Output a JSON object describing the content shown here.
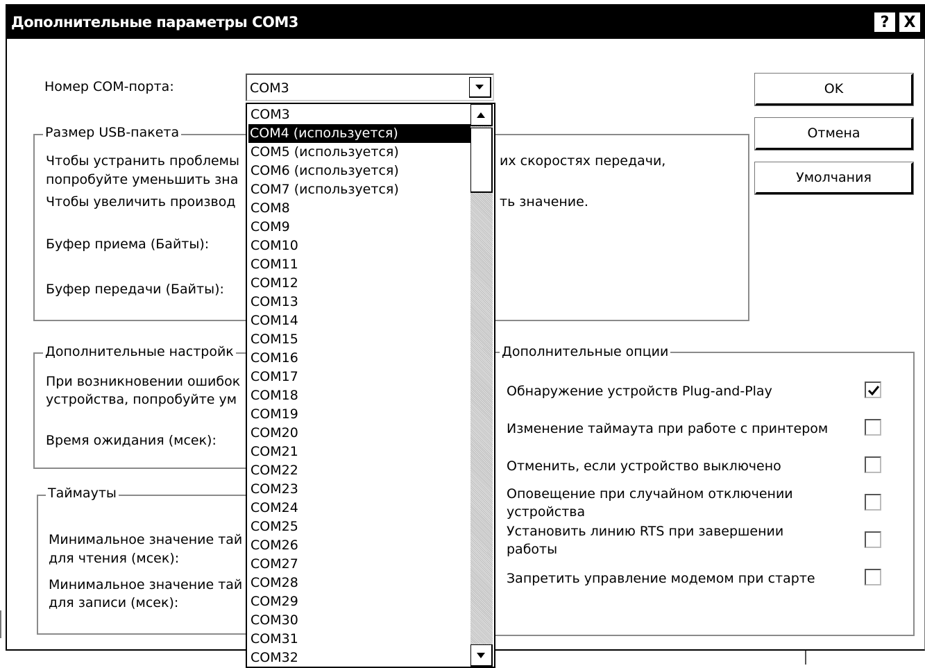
{
  "window": {
    "title": "Дополнительные параметры COM3",
    "help_btn": "?",
    "close_btn": "X"
  },
  "port": {
    "label": "Номер COM-порта:",
    "selected": "COM3",
    "options": [
      "COM3",
      "COM4 (используется)",
      "COM5 (используется)",
      "COM6 (используется)",
      "COM7 (используется)",
      "COM8",
      "COM9",
      "COM10",
      "COM11",
      "COM12",
      "COM13",
      "COM14",
      "COM15",
      "COM16",
      "COM17",
      "COM18",
      "COM19",
      "COM20",
      "COM21",
      "COM22",
      "COM23",
      "COM24",
      "COM25",
      "COM26",
      "COM27",
      "COM28",
      "COM29",
      "COM30",
      "COM31",
      "COM32"
    ],
    "highlighted": "COM4 (используется)"
  },
  "buttons": {
    "ok": "OK",
    "cancel": "Отмена",
    "defaults": "Умолчания"
  },
  "usb": {
    "legend": "Размер USB-пакета",
    "line1a": "Чтобы устранить проблемы",
    "line1b": "их скоростях передачи,",
    "line2": "попробуйте уменьшить зна",
    "line3a": "Чтобы увеличить производ",
    "line3b": "ть значение.",
    "rx_label": "Буфер приема (Байты):",
    "tx_label": "Буфер передачи (Байты):"
  },
  "advanced": {
    "legend": "Дополнительные настройк",
    "line1": "При возникновении ошибок",
    "line2": "устройства, попробуйте ум",
    "latency_label": "Время ожидания (мсек):"
  },
  "timeouts": {
    "legend": "Таймауты",
    "read_line1": "Минимальное значение тай",
    "read_line2": "для чтения (мсек):",
    "write_line1": "Минимальное значение тай",
    "write_line2": "для записи (мсек):"
  },
  "options": {
    "legend": "Дополнительные опции",
    "items": [
      {
        "label": "Обнаружение устройств Plug-and-Play",
        "checked": true
      },
      {
        "label": "Изменение таймаута при работе с принтером",
        "checked": false
      },
      {
        "label": "Отменить, если устройство выключено",
        "checked": false
      },
      {
        "label": "Оповещение при случайном отключении",
        "label2": "устройства",
        "checked": false
      },
      {
        "label": "Установить линию RTS при завершении",
        "label2": "работы",
        "checked": false
      },
      {
        "label": "Запретить управление модемом при старте",
        "checked": false
      }
    ]
  }
}
